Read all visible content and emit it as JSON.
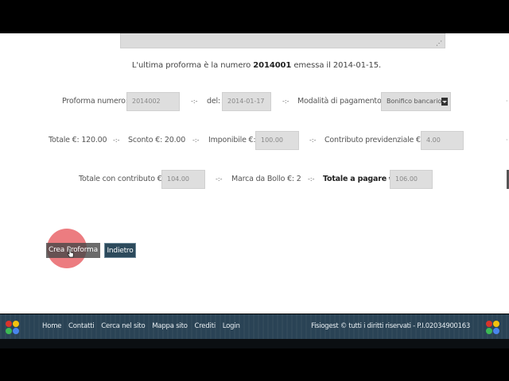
{
  "info": {
    "prefix": "L'ultima proforma è la numero ",
    "number": "2014001",
    "middle": " emessa il ",
    "date": "2014-01-15."
  },
  "row1": {
    "num_label": "Proforma numero:",
    "num_value": "2014002",
    "date_label": "del:",
    "date_value": "2014-01-17",
    "pay_label": "Modalità di pagamento:",
    "pay_value": "Bonifico bancario"
  },
  "row2": {
    "totale": "Totale €: 120.00",
    "sconto": "Sconto €: 20.00",
    "imp_label": "Imponibile €:",
    "imp_value": "100.00",
    "contr_label": "Contributo previdenziale €:",
    "contr_value": "4.00"
  },
  "row3": {
    "tcc_label": "Totale con contributo €:",
    "tcc_value": "104.00",
    "bollo": "Marca da Bollo €: 2",
    "tap_label": "Totale a pagare €:",
    "tap_value": "106.00"
  },
  "buttons": {
    "crea": "Crea Proforma",
    "indietro": "Indietro"
  },
  "separator": "-:-",
  "footer": {
    "nav": [
      "Home",
      "Contatti",
      "Cerca nel sito",
      "Mappa sito",
      "Crediti",
      "Login"
    ],
    "copyright": "Fisiogest © tutti i diritti riservati - P.I.02034900163"
  },
  "colors": {
    "footer_bg": "#2a4355",
    "button_blue": "#2c4a5c",
    "click_highlight": "#e85f64"
  }
}
